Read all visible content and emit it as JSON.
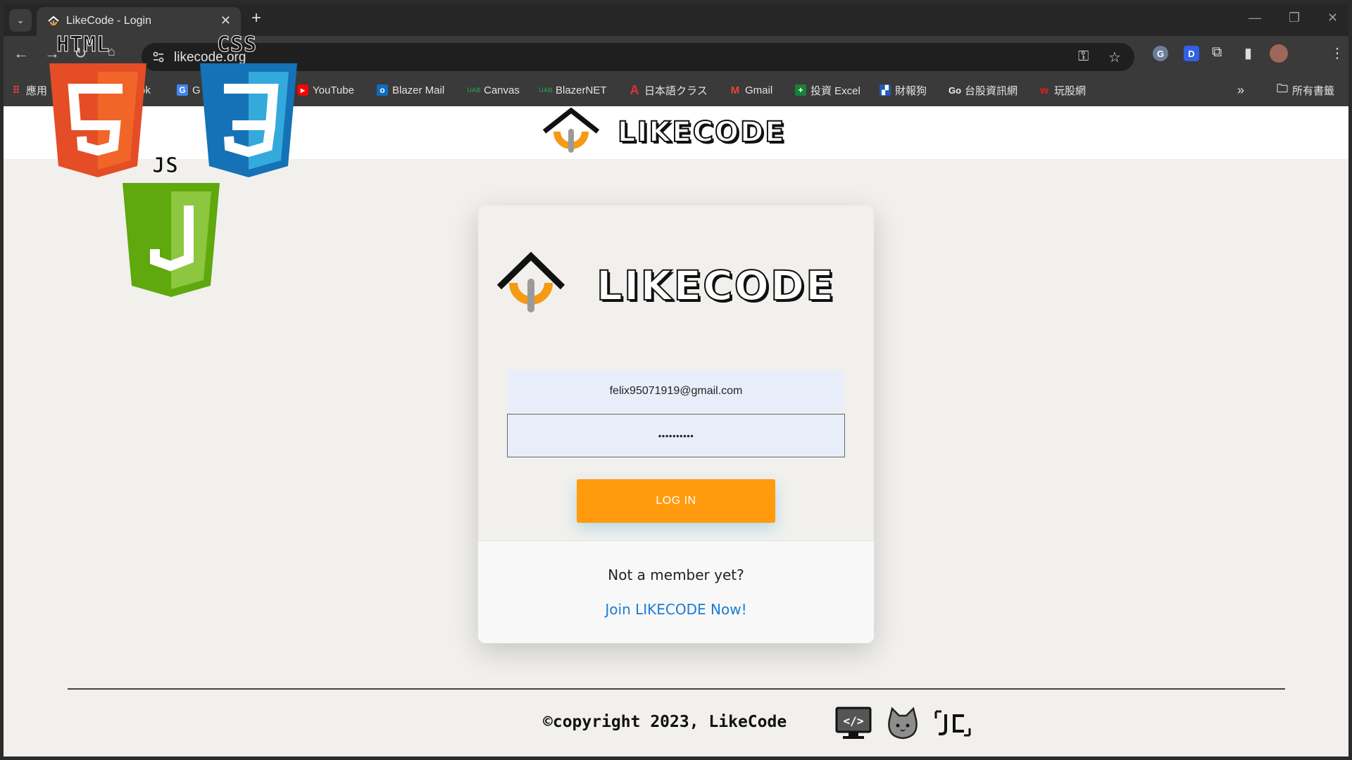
{
  "browser": {
    "tab_title": "LikeCode - Login",
    "url": "likecode.org",
    "bookmarks": [
      {
        "label": "應用",
        "icon": "apps-grid-icon",
        "color": "#e44"
      },
      {
        "label": "ok",
        "icon": "facebook-icon",
        "color": "#1877f2"
      },
      {
        "label": "G",
        "icon": "translate-icon",
        "color": "#4285f4"
      },
      {
        "label": "YouTube",
        "icon": "youtube-icon",
        "color": "#ff0000"
      },
      {
        "label": "Blazer Mail",
        "icon": "outlook-icon",
        "color": "#0f6cbd"
      },
      {
        "label": "Canvas",
        "icon": "canvas-icon",
        "color": "#2a8c4a"
      },
      {
        "label": "BlazerNET",
        "icon": "blazernet-icon",
        "color": "#2a8c4a"
      },
      {
        "label": "日本語クラス",
        "icon": "a-letter-icon",
        "color": "#e03030"
      },
      {
        "label": "Gmail",
        "icon": "gmail-icon",
        "color": "#ea4335"
      },
      {
        "label": "投資 Excel",
        "icon": "sheets-icon",
        "color": "#188038"
      },
      {
        "label": "財報狗",
        "icon": "dog-icon",
        "color": "#1e5bb8"
      },
      {
        "label": "台股資訊網",
        "icon": "go-icon",
        "color": "#111111"
      },
      {
        "label": "玩股網",
        "icon": "w-icon",
        "color": "#e02020"
      }
    ],
    "all_bookmarks_label": "所有書籤"
  },
  "header": {
    "brand": "LIKECODE"
  },
  "card": {
    "brand": "LIKECODE",
    "email_value": "felix95071919@gmail.com",
    "password_value": "••••••••••",
    "login_label": "LOG IN",
    "member_question": "Not a member yet?",
    "join_link": "Join LIKECODE Now!"
  },
  "footer": {
    "copyright": "©copyright 2023, LikeCode"
  },
  "overlay": {
    "html_label": "HTML",
    "css_label": "CSS",
    "js_label": "JS",
    "html_color": "#e44d26",
    "css_color": "#1f7ed6",
    "js_color": "#5fa80d"
  },
  "colors": {
    "accent": "#ff9b0d",
    "link": "#1a7bd6"
  }
}
